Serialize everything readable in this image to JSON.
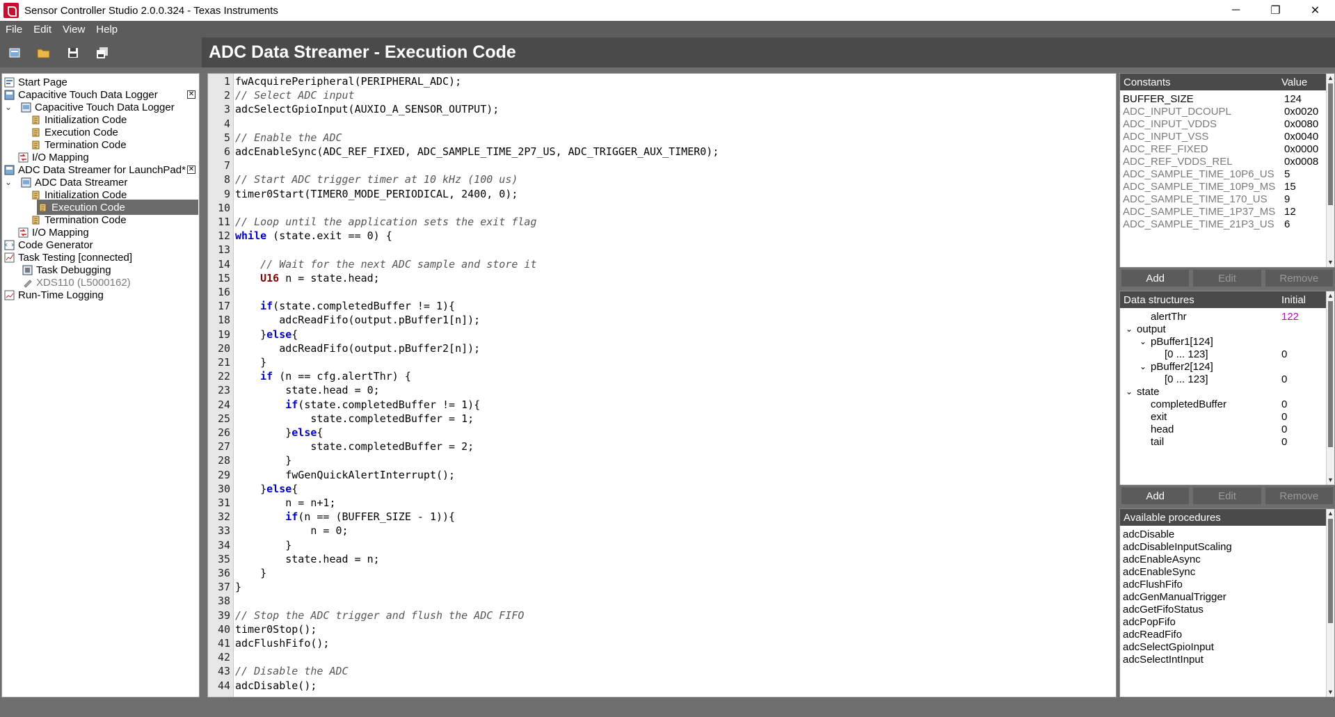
{
  "window": {
    "title": "Sensor Controller Studio 2.0.0.324 - Texas Instruments",
    "minimize": "─",
    "maximize": "❐",
    "close": "✕"
  },
  "menu": [
    "File",
    "Edit",
    "View",
    "Help"
  ],
  "header": {
    "title": "ADC Data Streamer - Execution Code"
  },
  "tree": {
    "start_page": "Start Page",
    "project1": "Capacitive Touch Data Logger",
    "task1": "Capacitive Touch Data Logger",
    "init1": "Initialization Code",
    "exec1": "Execution Code",
    "term1": "Termination Code",
    "io1": "I/O Mapping",
    "project2": "ADC Data Streamer for LaunchPad*",
    "task2": "ADC Data Streamer",
    "init2": "Initialization Code",
    "exec2": "Execution Code",
    "term2": "Termination Code",
    "io2": "I/O Mapping",
    "codegen": "Code Generator",
    "tasktest": "Task Testing [connected]",
    "taskdebug": "Task Debugging",
    "xds": "XDS110 (L5000162)",
    "rtlog": "Run-Time Logging"
  },
  "code": {
    "lines": [
      "fwAcquirePeripheral(PERIPHERAL_ADC);",
      "// Select ADC input",
      "adcSelectGpioInput(AUXIO_A_SENSOR_OUTPUT);",
      "",
      "// Enable the ADC",
      "adcEnableSync(ADC_REF_FIXED, ADC_SAMPLE_TIME_2P7_US, ADC_TRIGGER_AUX_TIMER0);",
      "",
      "// Start ADC trigger timer at 10 kHz (100 us)",
      "timer0Start(TIMER0_MODE_PERIODICAL, 2400, 0);",
      "",
      "// Loop until the application sets the exit flag",
      "while (state.exit == 0) {",
      "",
      "    // Wait for the next ADC sample and store it",
      "    U16 n = state.head;",
      "",
      "    if(state.completedBuffer != 1){",
      "       adcReadFifo(output.pBuffer1[n]);",
      "    }else{",
      "       adcReadFifo(output.pBuffer2[n]);",
      "    }",
      "    if (n == cfg.alertThr) {",
      "        state.head = 0;",
      "        if(state.completedBuffer != 1){",
      "            state.completedBuffer = 1;",
      "        }else{",
      "            state.completedBuffer = 2;",
      "        }",
      "        fwGenQuickAlertInterrupt();",
      "    }else{",
      "        n = n+1;",
      "        if(n == (BUFFER_SIZE - 1)){",
      "            n = 0;",
      "        }",
      "        state.head = n;",
      "    }",
      "}",
      "",
      "// Stop the ADC trigger and flush the ADC FIFO",
      "timer0Stop();",
      "adcFlushFifo();",
      "",
      "// Disable the ADC",
      "adcDisable();"
    ]
  },
  "constants": {
    "header_name": "Constants",
    "header_value": "Value",
    "rows": [
      {
        "name": "BUFFER_SIZE",
        "value": "124"
      },
      {
        "name": "ADC_INPUT_DCOUPL",
        "value": "0x0020"
      },
      {
        "name": "ADC_INPUT_VDDS",
        "value": "0x0080"
      },
      {
        "name": "ADC_INPUT_VSS",
        "value": "0x0040"
      },
      {
        "name": "ADC_REF_FIXED",
        "value": "0x0000"
      },
      {
        "name": "ADC_REF_VDDS_REL",
        "value": "0x0008"
      },
      {
        "name": "ADC_SAMPLE_TIME_10P6_US",
        "value": "5"
      },
      {
        "name": "ADC_SAMPLE_TIME_10P9_MS",
        "value": "15"
      },
      {
        "name": "ADC_SAMPLE_TIME_170_US",
        "value": "9"
      },
      {
        "name": "ADC_SAMPLE_TIME_1P37_MS",
        "value": "12"
      },
      {
        "name": "ADC_SAMPLE_TIME_21P3_US",
        "value": "6"
      }
    ]
  },
  "buttons": {
    "add": "Add",
    "edit": "Edit",
    "remove": "Remove"
  },
  "datastructs": {
    "header_name": "Data structures",
    "header_value": "Initial",
    "rows": [
      {
        "name": "alertThr",
        "value": "122"
      },
      {
        "name": "output",
        "value": ""
      },
      {
        "name": "pBuffer1[124]",
        "value": ""
      },
      {
        "name": "[0 ... 123]",
        "value": "0"
      },
      {
        "name": "pBuffer2[124]",
        "value": ""
      },
      {
        "name": "[0 ... 123]",
        "value": "0"
      },
      {
        "name": "state",
        "value": ""
      },
      {
        "name": "completedBuffer",
        "value": "0"
      },
      {
        "name": "exit",
        "value": "0"
      },
      {
        "name": "head",
        "value": "0"
      },
      {
        "name": "tail",
        "value": "0"
      }
    ]
  },
  "procedures": {
    "header": "Available procedures",
    "items": [
      "adcDisable",
      "adcDisableInputScaling",
      "adcEnableAsync",
      "adcEnableSync",
      "adcFlushFifo",
      "adcGenManualTrigger",
      "adcGetFifoStatus",
      "adcPopFifo",
      "adcReadFifo",
      "adcSelectGpioInput",
      "adcSelectIntInput"
    ]
  }
}
